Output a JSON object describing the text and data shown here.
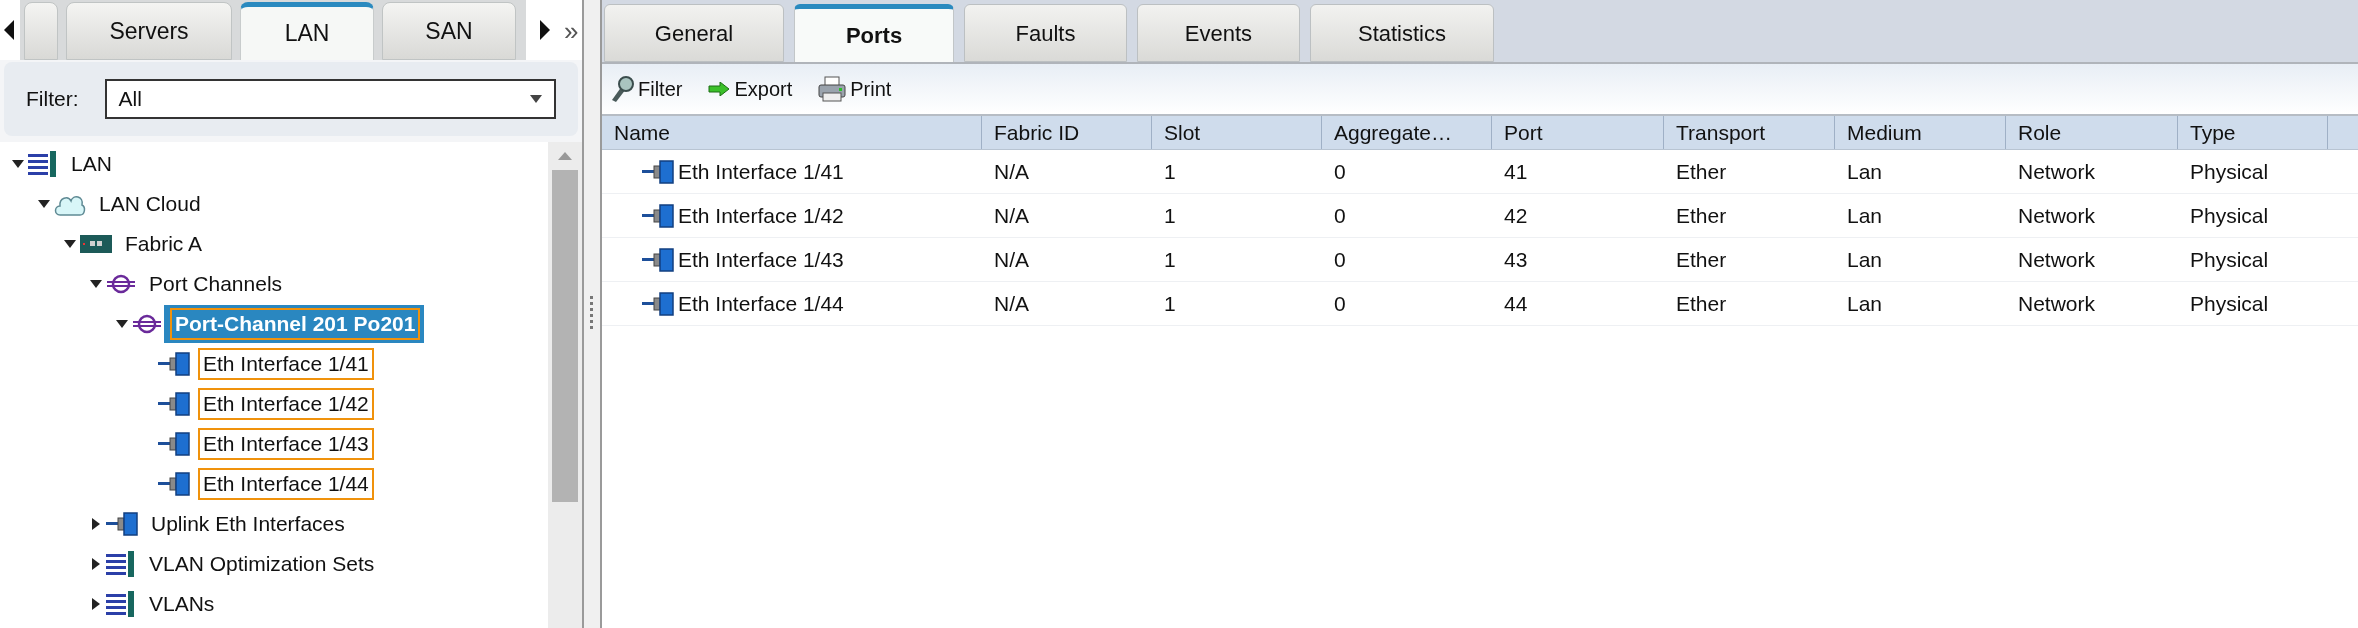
{
  "nav_tabs": [
    {
      "selected": false
    },
    {
      "label": "Servers",
      "selected": false
    },
    {
      "label": "LAN",
      "selected": true
    },
    {
      "label": "SAN",
      "selected": false
    }
  ],
  "nav_more": "»",
  "filter": {
    "label": "Filter:",
    "value": "All"
  },
  "tree": [
    {
      "label": "LAN",
      "kind": "list",
      "expanded": true,
      "selected": false,
      "outlined": false,
      "children": [
        {
          "label": "LAN Cloud",
          "kind": "cloud",
          "expanded": true,
          "selected": false,
          "outlined": false,
          "children": [
            {
              "label": "Fabric A",
              "kind": "fabric",
              "expanded": true,
              "selected": false,
              "outlined": false,
              "children": [
                {
                  "label": "Port Channels",
                  "kind": "portchannel",
                  "expanded": true,
                  "selected": false,
                  "outlined": false,
                  "children": [
                    {
                      "label": "Port-Channel 201 Po201",
                      "kind": "portchannel",
                      "expanded": true,
                      "selected": true,
                      "outlined": true,
                      "children": [
                        {
                          "label": "Eth Interface 1/41",
                          "kind": "port",
                          "selected": false,
                          "outlined": true
                        },
                        {
                          "label": "Eth Interface 1/42",
                          "kind": "port",
                          "selected": false,
                          "outlined": true
                        },
                        {
                          "label": "Eth Interface 1/43",
                          "kind": "port",
                          "selected": false,
                          "outlined": true
                        },
                        {
                          "label": "Eth Interface 1/44",
                          "kind": "port",
                          "selected": false,
                          "outlined": true
                        }
                      ]
                    }
                  ]
                },
                {
                  "label": "Uplink Eth Interfaces",
                  "kind": "port",
                  "expanded": false,
                  "selected": false,
                  "outlined": false
                },
                {
                  "label": "VLAN Optimization Sets",
                  "kind": "list",
                  "expanded": false,
                  "selected": false,
                  "outlined": false
                },
                {
                  "label": "VLANs",
                  "kind": "list",
                  "expanded": false,
                  "selected": false,
                  "outlined": false
                }
              ]
            }
          ]
        }
      ]
    }
  ],
  "detail_tabs": [
    {
      "label": "General",
      "selected": false
    },
    {
      "label": "Ports",
      "selected": true
    },
    {
      "label": "Faults",
      "selected": false
    },
    {
      "label": "Events",
      "selected": false
    },
    {
      "label": "Statistics",
      "selected": false
    }
  ],
  "toolbar": [
    {
      "label": "Filter",
      "kind": "filter"
    },
    {
      "label": "Export",
      "kind": "export"
    },
    {
      "label": "Print",
      "kind": "print"
    }
  ],
  "table": {
    "columns": [
      "Name",
      "Fabric ID",
      "Slot",
      "Aggregate…",
      "Port",
      "Transport",
      "Medium",
      "Role",
      "Type"
    ],
    "rows": [
      [
        "Eth Interface 1/41",
        "N/A",
        "1",
        "0",
        "41",
        "Ether",
        "Lan",
        "Network",
        "Physical"
      ],
      [
        "Eth Interface 1/42",
        "N/A",
        "1",
        "0",
        "42",
        "Ether",
        "Lan",
        "Network",
        "Physical"
      ],
      [
        "Eth Interface 1/43",
        "N/A",
        "1",
        "0",
        "43",
        "Ether",
        "Lan",
        "Network",
        "Physical"
      ],
      [
        "Eth Interface 1/44",
        "N/A",
        "1",
        "0",
        "44",
        "Ether",
        "Lan",
        "Network",
        "Physical"
      ]
    ]
  }
}
